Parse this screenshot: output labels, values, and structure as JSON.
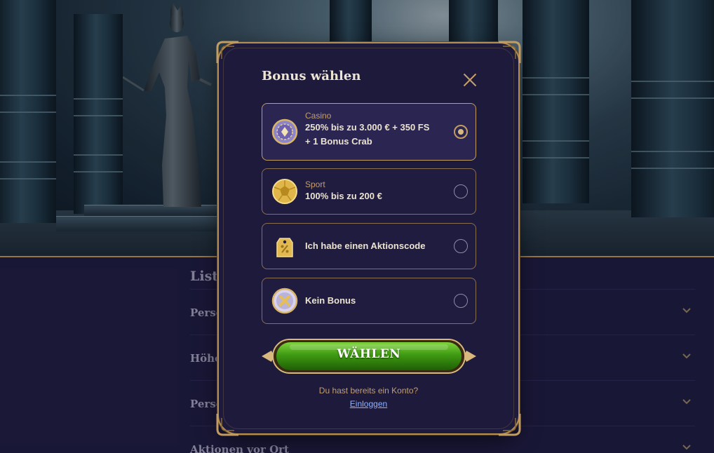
{
  "background": {
    "title_visible": "Liste",
    "accordion": [
      {
        "label": "Persö"
      },
      {
        "label": "Höhe"
      },
      {
        "label": "Perso"
      },
      {
        "label": "Aktionen vor Ort"
      }
    ]
  },
  "modal": {
    "title": "Bonus wählen",
    "options": [
      {
        "category": "Casino",
        "line1": "250% bis zu 3.000 € + 350 FS",
        "line2": "+ 1 Bonus Crab",
        "icon": "casino-chip-icon",
        "selected": true
      },
      {
        "category": "Sport",
        "line1": "100% bis zu 200 €",
        "line2": "",
        "icon": "football-icon",
        "selected": false
      },
      {
        "category": "",
        "line1": "Ich habe einen Aktionscode",
        "line2": "",
        "icon": "promo-tag-icon",
        "selected": false
      },
      {
        "category": "",
        "line1": "Kein Bonus",
        "line2": "",
        "icon": "no-bonus-icon",
        "selected": false
      }
    ],
    "choose_label": "WÄHLEN",
    "account_question": "Du hast bereits ein Konto?",
    "login_label": "Einloggen"
  },
  "colors": {
    "accent_gold": "#c39c61",
    "modal_bg": "#1d1a3c",
    "button_green": "#3f9a12",
    "link_blue": "#8fb2ff"
  }
}
